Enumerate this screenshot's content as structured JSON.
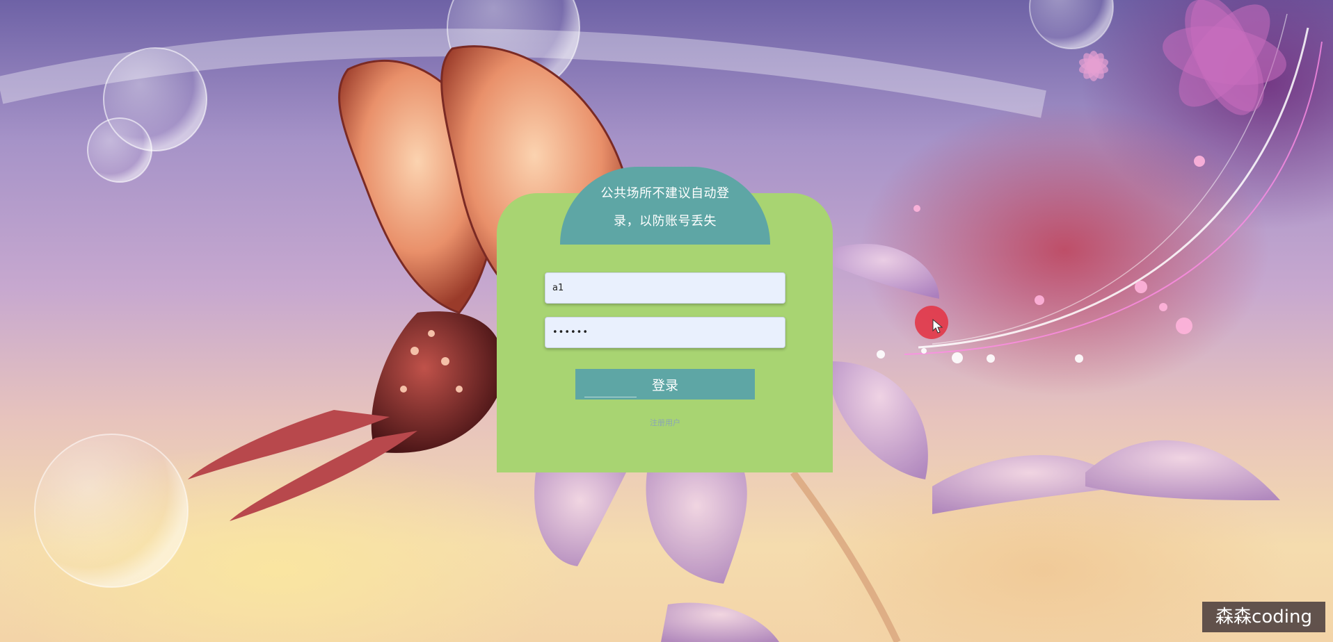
{
  "login": {
    "notice": "公共场所不建议自动登录，以防账号丢失",
    "username_value": "a1",
    "password_value": "••••••",
    "submit_label": "登录",
    "register_link": "注册用户"
  },
  "watermark": "森森coding",
  "colors": {
    "panel": "#a8d472",
    "accent": "#5ea6a5",
    "input_bg": "#e9f0fd",
    "cursor_highlight": "#e23444"
  },
  "icons": {
    "cursor": "mouse-pointer-icon"
  }
}
